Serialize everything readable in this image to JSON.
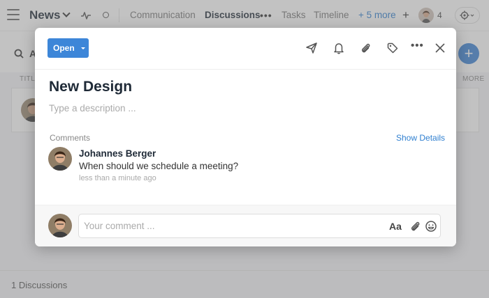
{
  "topbar": {
    "app_title": "News",
    "tabs": [
      {
        "label": "Communication",
        "active": false
      },
      {
        "label": "Discussions",
        "active": true
      },
      {
        "label": "Tasks",
        "active": false
      },
      {
        "label": "Timeline",
        "active": false
      }
    ],
    "more_tabs": "+ 5 more",
    "member_count": "4"
  },
  "list": {
    "search_letter": "A",
    "col_title": "TITLE",
    "col_more": "MORE",
    "footer_count": "1 Discussions"
  },
  "modal": {
    "status_label": "Open",
    "title": "New Design",
    "description_placeholder": "Type a description ...",
    "comments_label": "Comments",
    "show_details": "Show Details",
    "comments": [
      {
        "author": "Johannes Berger",
        "text": "When should we schedule a meeting?",
        "time": "less than a minute ago"
      }
    ],
    "comment_placeholder": "Your comment ...",
    "format_label": "Aa"
  },
  "colors": {
    "accent": "#3d86d8",
    "link": "#2f7fd0",
    "title": "#1f2a37"
  }
}
